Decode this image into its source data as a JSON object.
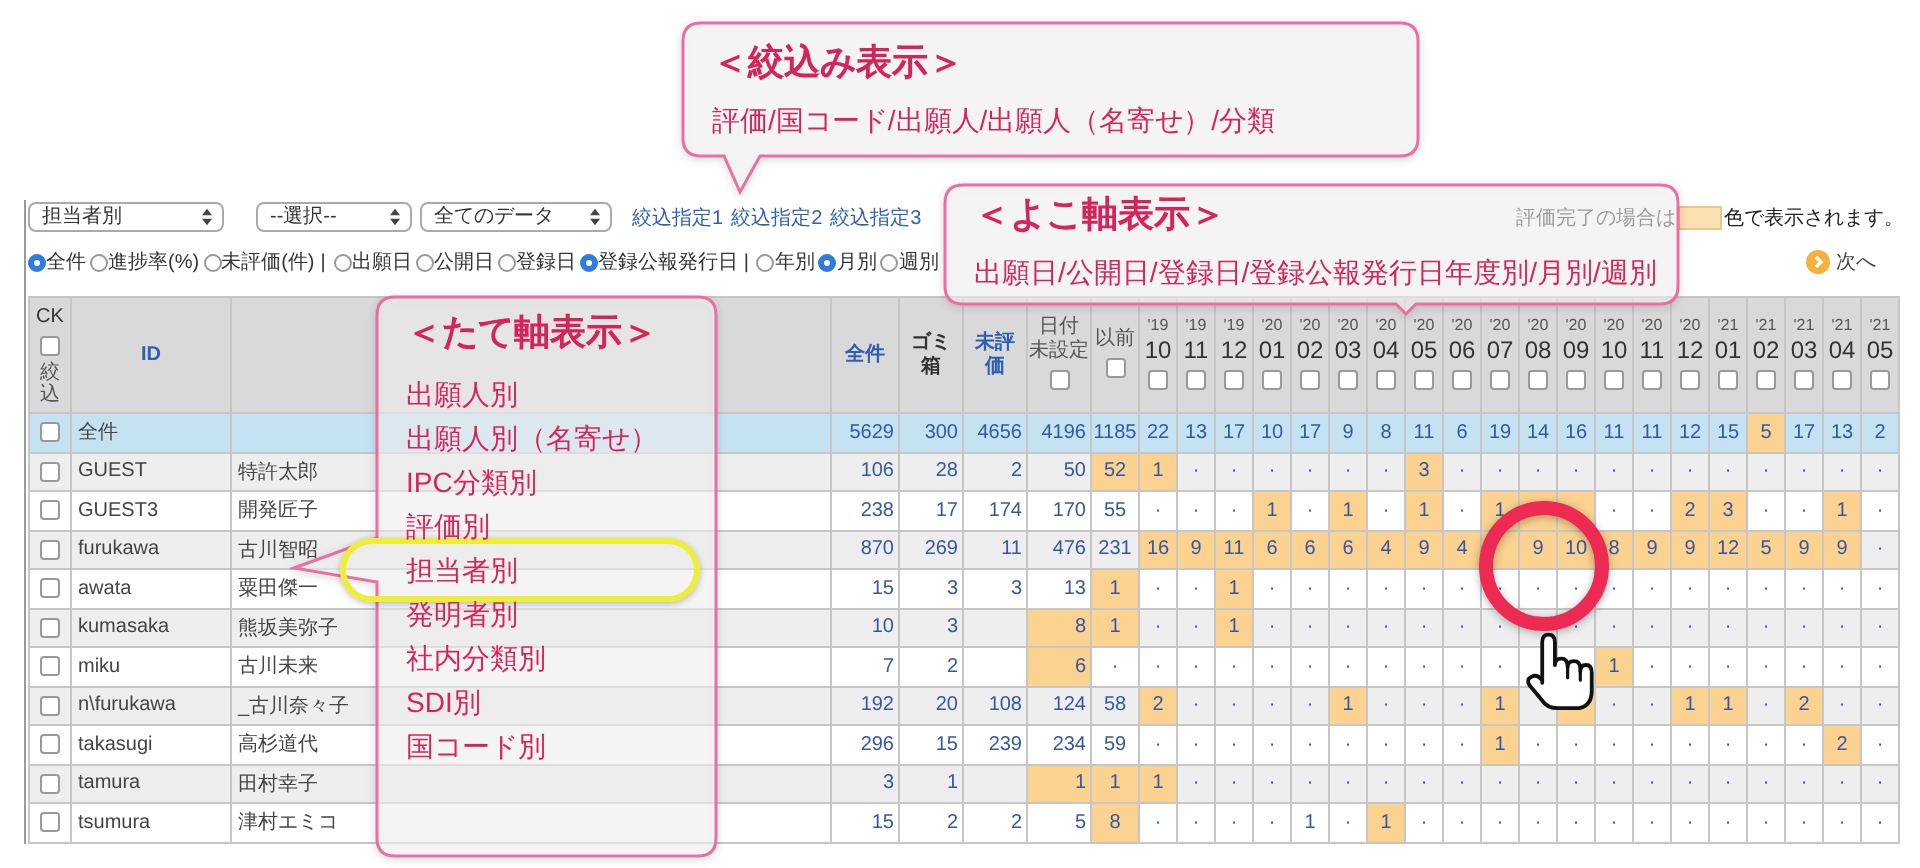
{
  "filter_bar": {
    "selects": [
      {
        "value": "担当者別"
      },
      {
        "value": "--選択--"
      },
      {
        "value": "全てのデータ"
      }
    ],
    "links": [
      "絞込指定1",
      "絞込指定2",
      "絞込指定3"
    ],
    "legend": {
      "before": "評価完了の場合は",
      "after": "色で表示されます。"
    }
  },
  "options_bar": {
    "groups": [
      {
        "options": [
          {
            "label": "全件",
            "selected": true
          },
          {
            "label": "進捗率(%)",
            "selected": false
          },
          {
            "label": "未評価(件)",
            "selected": false
          }
        ],
        "separator": "|"
      },
      {
        "options": [
          {
            "label": "出願日",
            "selected": false
          },
          {
            "label": "公開日",
            "selected": false
          },
          {
            "label": "登録日",
            "selected": false
          },
          {
            "label": "登録公報発行日",
            "selected": true
          }
        ],
        "separator": "|"
      },
      {
        "options": [
          {
            "label": "年別",
            "selected": false
          },
          {
            "label": "月別",
            "selected": true
          },
          {
            "label": "週別",
            "selected": false
          }
        ]
      }
    ],
    "next": "次へ"
  },
  "table": {
    "header": {
      "ck": {
        "label": "CK",
        "note": "絞込",
        "checked": false
      },
      "id": "ID",
      "total": "全件",
      "trash": [
        "ゴミ",
        "箱"
      ],
      "unrated": [
        "未評",
        "価"
      ],
      "undated": {
        "lines": [
          "日付",
          "未設定"
        ],
        "checked": false
      },
      "before": {
        "label": "以前",
        "checked": false
      },
      "months": [
        {
          "year": "'19",
          "month": "10",
          "checked": false
        },
        {
          "year": "'19",
          "month": "11",
          "checked": false
        },
        {
          "year": "'19",
          "month": "12",
          "checked": false
        },
        {
          "year": "'20",
          "month": "01",
          "checked": false
        },
        {
          "year": "'20",
          "month": "02",
          "checked": false
        },
        {
          "year": "'20",
          "month": "03",
          "checked": false
        },
        {
          "year": "'20",
          "month": "04",
          "checked": false
        },
        {
          "year": "'20",
          "month": "05",
          "checked": false
        },
        {
          "year": "'20",
          "month": "06",
          "checked": false
        },
        {
          "year": "'20",
          "month": "07",
          "checked": false
        },
        {
          "year": "'20",
          "month": "08",
          "checked": false
        },
        {
          "year": "'20",
          "month": "09",
          "checked": false
        },
        {
          "year": "'20",
          "month": "10",
          "checked": false
        },
        {
          "year": "'20",
          "month": "11",
          "checked": false
        },
        {
          "year": "'20",
          "month": "12",
          "checked": false
        },
        {
          "year": "'21",
          "month": "01",
          "checked": false
        },
        {
          "year": "'21",
          "month": "02",
          "checked": false
        },
        {
          "year": "'21",
          "month": "03",
          "checked": false
        },
        {
          "year": "'21",
          "month": "04",
          "checked": false
        },
        {
          "year": "'21",
          "month": "05",
          "checked": false
        }
      ]
    },
    "rows": [
      {
        "kind": "total",
        "id": "全件",
        "checked": false,
        "cells": [
          {
            "text": "5629",
            "done": false
          },
          {
            "text": "300",
            "done": false
          },
          {
            "text": "4656",
            "done": false
          },
          {
            "text": "4196",
            "done": false
          },
          {
            "text": "1185",
            "done": false
          },
          {
            "text": "22",
            "done": false
          },
          {
            "text": "13",
            "done": false
          },
          {
            "text": "17",
            "done": false
          },
          {
            "text": "10",
            "done": false
          },
          {
            "text": "17",
            "done": false
          },
          {
            "text": "9",
            "done": false
          },
          {
            "text": "8",
            "done": false
          },
          {
            "text": "11",
            "done": false
          },
          {
            "text": "6",
            "done": false
          },
          {
            "text": "19",
            "done": false
          },
          {
            "text": "14",
            "done": false
          },
          {
            "text": "16",
            "done": false
          },
          {
            "text": "11",
            "done": false
          },
          {
            "text": "11",
            "done": false
          },
          {
            "text": "12",
            "done": false
          },
          {
            "text": "15",
            "done": false
          },
          {
            "text": "5",
            "done": true
          },
          {
            "text": "17",
            "done": false
          },
          {
            "text": "13",
            "done": false
          },
          {
            "text": "2",
            "done": false
          }
        ]
      },
      {
        "kind": "user",
        "id": "GUEST",
        "name": "特許太郎",
        "checked": false,
        "cells": [
          {
            "text": "106",
            "done": false
          },
          {
            "text": "28",
            "done": false
          },
          {
            "text": "2",
            "done": false
          },
          {
            "text": "50",
            "done": false
          },
          {
            "text": "52",
            "done": true
          },
          {
            "text": "1",
            "done": true
          },
          {
            "text": "·",
            "done": false
          },
          {
            "text": "·",
            "done": false
          },
          {
            "text": "·",
            "done": false
          },
          {
            "text": "·",
            "done": false
          },
          {
            "text": "·",
            "done": false
          },
          {
            "text": "·",
            "done": false
          },
          {
            "text": "3",
            "done": true
          },
          {
            "text": "·",
            "done": false
          },
          {
            "text": "·",
            "done": false
          },
          {
            "text": "·",
            "done": false
          },
          {
            "text": "·",
            "done": false
          },
          {
            "text": "·",
            "done": false
          },
          {
            "text": "·",
            "done": false
          },
          {
            "text": "·",
            "done": false
          },
          {
            "text": "·",
            "done": false
          },
          {
            "text": "·",
            "done": false
          },
          {
            "text": "·",
            "done": false
          },
          {
            "text": "·",
            "done": false
          },
          {
            "text": "·",
            "done": false
          }
        ]
      },
      {
        "kind": "user",
        "id": "GUEST3",
        "name": "開発匠子",
        "checked": false,
        "cells": [
          {
            "text": "238",
            "done": false
          },
          {
            "text": "17",
            "done": false
          },
          {
            "text": "174",
            "done": false
          },
          {
            "text": "170",
            "done": false
          },
          {
            "text": "55",
            "done": false
          },
          {
            "text": "·",
            "done": false
          },
          {
            "text": "·",
            "done": false
          },
          {
            "text": "·",
            "done": false
          },
          {
            "text": "1",
            "done": true
          },
          {
            "text": "·",
            "done": false
          },
          {
            "text": "1",
            "done": true
          },
          {
            "text": "·",
            "done": false
          },
          {
            "text": "1",
            "done": true
          },
          {
            "text": "·",
            "done": false
          },
          {
            "text": "1",
            "done": true
          },
          {
            "done": true
          },
          {
            "done": true
          },
          {
            "text": "·",
            "done": false
          },
          {
            "text": "·",
            "done": false
          },
          {
            "text": "2",
            "done": true
          },
          {
            "text": "3",
            "done": true
          },
          {
            "text": "·",
            "done": false
          },
          {
            "text": "·",
            "done": false
          },
          {
            "text": "1",
            "done": true
          },
          {
            "text": "·",
            "done": false
          }
        ]
      },
      {
        "kind": "user",
        "id": "furukawa",
        "name": "古川智昭",
        "checked": false,
        "cells": [
          {
            "text": "870",
            "done": false
          },
          {
            "text": "269",
            "done": false
          },
          {
            "text": "11",
            "done": false
          },
          {
            "text": "476",
            "done": false
          },
          {
            "text": "231",
            "done": false
          },
          {
            "text": "16",
            "done": true
          },
          {
            "text": "9",
            "done": true
          },
          {
            "text": "11",
            "done": true
          },
          {
            "text": "6",
            "done": true
          },
          {
            "text": "6",
            "done": true
          },
          {
            "text": "6",
            "done": true
          },
          {
            "text": "4",
            "done": true
          },
          {
            "text": "9",
            "done": true
          },
          {
            "text": "4",
            "done": true
          },
          {
            "done": true
          },
          {
            "text": "9",
            "done": true
          },
          {
            "text": "10",
            "done": true
          },
          {
            "text": "8",
            "done": true
          },
          {
            "text": "9",
            "done": true
          },
          {
            "text": "9",
            "done": true
          },
          {
            "text": "12",
            "done": true
          },
          {
            "text": "5",
            "done": true
          },
          {
            "text": "9",
            "done": true
          },
          {
            "text": "9",
            "done": true
          },
          {
            "text": "·",
            "done": false
          }
        ]
      },
      {
        "kind": "user",
        "id": "awata",
        "name": "粟田傑一",
        "checked": false,
        "cells": [
          {
            "text": "15",
            "done": false
          },
          {
            "text": "3",
            "done": false
          },
          {
            "text": "3",
            "done": false
          },
          {
            "text": "13",
            "done": false
          },
          {
            "text": "1",
            "done": true
          },
          {
            "text": "·",
            "done": false
          },
          {
            "text": "·",
            "done": false
          },
          {
            "text": "1",
            "done": true
          },
          {
            "text": "·",
            "done": false
          },
          {
            "text": "·",
            "done": false
          },
          {
            "text": "·",
            "done": false
          },
          {
            "text": "·",
            "done": false
          },
          {
            "text": "·",
            "done": false
          },
          {
            "text": "·",
            "done": false
          },
          {
            "text": "·",
            "done": false
          },
          {
            "text": "·",
            "done": false
          },
          {
            "text": "·",
            "done": false
          },
          {
            "text": "·",
            "done": false
          },
          {
            "text": "·",
            "done": false
          },
          {
            "text": "·",
            "done": false
          },
          {
            "text": "·",
            "done": false
          },
          {
            "text": "·",
            "done": false
          },
          {
            "text": "·",
            "done": false
          },
          {
            "text": "·",
            "done": false
          },
          {
            "text": "·",
            "done": false
          }
        ]
      },
      {
        "kind": "user",
        "id": "kumasaka",
        "name": "熊坂美弥子",
        "checked": false,
        "cells": [
          {
            "text": "10",
            "done": false
          },
          {
            "text": "3",
            "done": false
          },
          {
            "done": false
          },
          {
            "text": "8",
            "done": true
          },
          {
            "text": "1",
            "done": true
          },
          {
            "text": "·",
            "done": false
          },
          {
            "text": "·",
            "done": false
          },
          {
            "text": "1",
            "done": true
          },
          {
            "text": "·",
            "done": false
          },
          {
            "text": "·",
            "done": false
          },
          {
            "text": "·",
            "done": false
          },
          {
            "text": "·",
            "done": false
          },
          {
            "text": "·",
            "done": false
          },
          {
            "text": "·",
            "done": false
          },
          {
            "text": "·",
            "done": false
          },
          {
            "done": false
          },
          {
            "text": "·",
            "done": false
          },
          {
            "text": "·",
            "done": false
          },
          {
            "text": "·",
            "done": false
          },
          {
            "text": "·",
            "done": false
          },
          {
            "text": "·",
            "done": false
          },
          {
            "text": "·",
            "done": false
          },
          {
            "text": "·",
            "done": false
          },
          {
            "text": "·",
            "done": false
          },
          {
            "text": "·",
            "done": false
          }
        ]
      },
      {
        "kind": "user",
        "id": "miku",
        "name": "古川未来",
        "checked": false,
        "cells": [
          {
            "text": "7",
            "done": false
          },
          {
            "text": "2",
            "done": false
          },
          {
            "done": false
          },
          {
            "text": "6",
            "done": true
          },
          {
            "text": "·",
            "done": false
          },
          {
            "text": "·",
            "done": false
          },
          {
            "text": "·",
            "done": false
          },
          {
            "text": "·",
            "done": false
          },
          {
            "text": "·",
            "done": false
          },
          {
            "text": "·",
            "done": false
          },
          {
            "text": "·",
            "done": false
          },
          {
            "text": "·",
            "done": false
          },
          {
            "text": "·",
            "done": false
          },
          {
            "text": "·",
            "done": false
          },
          {
            "text": "·",
            "done": false
          },
          {
            "done": false
          },
          {
            "done": false
          },
          {
            "text": "1",
            "done": true
          },
          {
            "text": "·",
            "done": false
          },
          {
            "text": "·",
            "done": false
          },
          {
            "text": "·",
            "done": false
          },
          {
            "text": "·",
            "done": false
          },
          {
            "text": "·",
            "done": false
          },
          {
            "text": "·",
            "done": false
          },
          {
            "text": "·",
            "done": false
          }
        ]
      },
      {
        "kind": "user",
        "id": "n\\furukawa",
        "name": "_古川奈々子",
        "checked": false,
        "cells": [
          {
            "text": "192",
            "done": false
          },
          {
            "text": "20",
            "done": false
          },
          {
            "text": "108",
            "done": false
          },
          {
            "text": "124",
            "done": false
          },
          {
            "text": "58",
            "done": false
          },
          {
            "text": "2",
            "done": true
          },
          {
            "text": "·",
            "done": false
          },
          {
            "text": "·",
            "done": false
          },
          {
            "text": "·",
            "done": false
          },
          {
            "text": "·",
            "done": false
          },
          {
            "text": "1",
            "done": true
          },
          {
            "text": "·",
            "done": false
          },
          {
            "text": "·",
            "done": false
          },
          {
            "text": "·",
            "done": false
          },
          {
            "text": "1",
            "done": true
          },
          {
            "done": false
          },
          {
            "done": true
          },
          {
            "text": "·",
            "done": false
          },
          {
            "text": "·",
            "done": false
          },
          {
            "text": "1",
            "done": true
          },
          {
            "text": "1",
            "done": true
          },
          {
            "text": "·",
            "done": false
          },
          {
            "text": "2",
            "done": true
          },
          {
            "text": "·",
            "done": false
          },
          {
            "text": "·",
            "done": false
          }
        ]
      },
      {
        "kind": "user",
        "id": "takasugi",
        "name": "高杉道代",
        "checked": false,
        "cells": [
          {
            "text": "296",
            "done": false
          },
          {
            "text": "15",
            "done": false
          },
          {
            "text": "239",
            "done": false
          },
          {
            "text": "234",
            "done": false
          },
          {
            "text": "59",
            "done": false
          },
          {
            "text": "·",
            "done": false
          },
          {
            "text": "·",
            "done": false
          },
          {
            "text": "·",
            "done": false
          },
          {
            "text": "·",
            "done": false
          },
          {
            "text": "·",
            "done": false
          },
          {
            "text": "·",
            "done": false
          },
          {
            "text": "·",
            "done": false
          },
          {
            "text": "·",
            "done": false
          },
          {
            "text": "·",
            "done": false
          },
          {
            "text": "1",
            "done": true
          },
          {
            "text": "·",
            "done": false
          },
          {
            "text": "·",
            "done": false
          },
          {
            "text": "·",
            "done": false
          },
          {
            "text": "·",
            "done": false
          },
          {
            "text": "·",
            "done": false
          },
          {
            "text": "·",
            "done": false
          },
          {
            "text": "·",
            "done": false
          },
          {
            "text": "·",
            "done": false
          },
          {
            "text": "2",
            "done": true
          },
          {
            "text": "·",
            "done": false
          }
        ]
      },
      {
        "kind": "user",
        "id": "tamura",
        "name": "田村幸子",
        "checked": false,
        "cells": [
          {
            "text": "3",
            "done": false
          },
          {
            "text": "1",
            "done": false
          },
          {
            "done": false
          },
          {
            "text": "1",
            "done": true
          },
          {
            "text": "1",
            "done": true
          },
          {
            "text": "1",
            "done": true
          },
          {
            "text": "·",
            "done": false
          },
          {
            "text": "·",
            "done": false
          },
          {
            "text": "·",
            "done": false
          },
          {
            "text": "·",
            "done": false
          },
          {
            "text": "·",
            "done": false
          },
          {
            "text": "·",
            "done": false
          },
          {
            "text": "·",
            "done": false
          },
          {
            "text": "·",
            "done": false
          },
          {
            "text": "·",
            "done": false
          },
          {
            "text": "·",
            "done": false
          },
          {
            "text": "·",
            "done": false
          },
          {
            "text": "·",
            "done": false
          },
          {
            "text": "·",
            "done": false
          },
          {
            "text": "·",
            "done": false
          },
          {
            "text": "·",
            "done": false
          },
          {
            "text": "·",
            "done": false
          },
          {
            "text": "·",
            "done": false
          },
          {
            "text": "·",
            "done": false
          },
          {
            "text": "·",
            "done": false
          }
        ]
      },
      {
        "kind": "user",
        "id": "tsumura",
        "name": "津村エミコ",
        "checked": false,
        "cells": [
          {
            "text": "15",
            "done": false
          },
          {
            "text": "2",
            "done": false
          },
          {
            "text": "2",
            "done": false
          },
          {
            "text": "5",
            "done": false
          },
          {
            "text": "8",
            "done": true
          },
          {
            "text": "·",
            "done": false
          },
          {
            "text": "·",
            "done": false
          },
          {
            "text": "·",
            "done": false
          },
          {
            "text": "·",
            "done": false
          },
          {
            "text": "1",
            "done": false
          },
          {
            "text": "·",
            "done": false
          },
          {
            "text": "1",
            "done": true
          },
          {
            "text": "·",
            "done": false
          },
          {
            "text": "·",
            "done": false
          },
          {
            "text": "·",
            "done": false
          },
          {
            "text": "·",
            "done": false
          },
          {
            "text": "·",
            "done": false
          },
          {
            "text": "·",
            "done": false
          },
          {
            "text": "·",
            "done": false
          },
          {
            "text": "·",
            "done": false
          },
          {
            "text": "·",
            "done": false
          },
          {
            "text": "·",
            "done": false
          },
          {
            "text": "·",
            "done": false
          },
          {
            "text": "·",
            "done": false
          },
          {
            "text": "·",
            "done": false
          }
        ]
      }
    ]
  },
  "callouts": [
    {
      "kind": "filter",
      "title": "＜絞込み表示＞",
      "text": "評価/国コード/出願人/出願人（名寄せ）/分類"
    },
    {
      "kind": "horizontal",
      "title": "＜よこ軸表示＞",
      "text": "出願日/公開日/登録日/登録公報発行日年度別/月別/週別"
    },
    {
      "kind": "vertical",
      "title": "＜たて軸表示＞",
      "items": [
        {
          "label": "出願人別",
          "selected": false
        },
        {
          "label": "出願人別（名寄せ）",
          "selected": false
        },
        {
          "label": "IPC分類別",
          "selected": false
        },
        {
          "label": "評価別",
          "selected": false
        },
        {
          "label": "担当者別",
          "selected": true
        },
        {
          "label": "発明者別",
          "selected": false
        },
        {
          "label": "社内分類別",
          "selected": false
        },
        {
          "label": "SDI別",
          "selected": false
        },
        {
          "label": "国コード別",
          "selected": false
        }
      ]
    }
  ]
}
